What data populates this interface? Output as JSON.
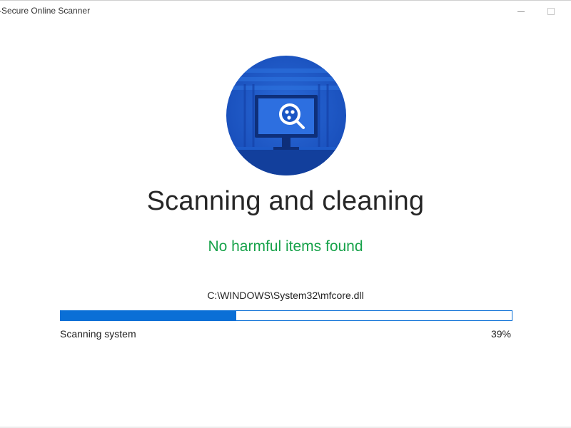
{
  "window": {
    "title": "-Secure Online Scanner"
  },
  "main": {
    "heading": "Scanning and cleaning",
    "status_message": "No harmful items found",
    "current_file": "C:\\WINDOWS\\System32\\mfcore.dll"
  },
  "progress": {
    "label": "Scanning system",
    "percent_text": "39%",
    "fraction": 0.39
  },
  "icons": {
    "hero": "monitor-magnifier-icon",
    "minimize": "minimize-icon",
    "maximize": "maximize-icon"
  },
  "colors": {
    "accent": "#0a6fd6",
    "status_ok": "#17a24a",
    "hero_circle": "#1a56c4"
  }
}
